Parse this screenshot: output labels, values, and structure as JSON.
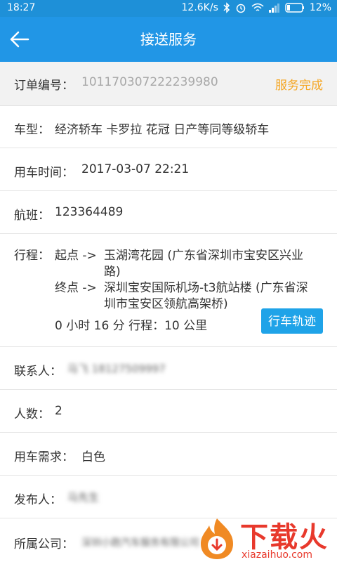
{
  "statusbar": {
    "time": "18:27",
    "speed": "12.6K/s",
    "battery": "12%"
  },
  "header": {
    "title": "接送服务"
  },
  "order": {
    "label": "订单编号：",
    "number": "101170307222239980",
    "status": "服务完成"
  },
  "fields": {
    "car_type_label": "车型：",
    "car_type_value": "经济轿车 卡罗拉 花冠 日产等同等级轿车",
    "time_label": "用车时间：",
    "time_value": "2017-03-07 22:21",
    "flight_label": "航班：",
    "flight_value": "123364489",
    "trip_label": "行程：",
    "start_label": "起点 ->",
    "start_value_1": "玉湖湾花园 (广东省深圳市宝安区兴业",
    "start_value_2": "路)",
    "end_label": "终点 ->",
    "end_value_1": "深圳宝安国际机场-t3航站楼 (广东省深",
    "end_value_2": "圳市宝安区领航高架桥)",
    "trip_summary": "0 小时 16 分 行程：10 公里",
    "track_button": "行车轨迹",
    "contact_label": "联系人：",
    "contact_value": "马飞 18127509997",
    "people_label": "人数：",
    "people_value": "2",
    "need_label": "用车需求：",
    "need_value": "白色",
    "publisher_label": "发布人：",
    "publisher_value": "马先生",
    "company_label": "所属公司：",
    "company_value": "深圳小跑汽车服务有限公司"
  },
  "watermark": {
    "name": "下载火",
    "url": "xiazaihuo.com"
  }
}
